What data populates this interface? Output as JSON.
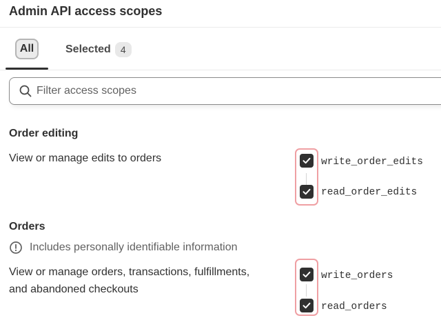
{
  "header": {
    "title": "Admin API access scopes"
  },
  "tabs": {
    "all_label": "All",
    "selected_label": "Selected",
    "selected_count": "4"
  },
  "search": {
    "placeholder": "Filter access scopes",
    "value": ""
  },
  "sections": [
    {
      "title": "Order editing",
      "description": "View or manage edits to orders",
      "scopes": [
        {
          "label": "write_order_edits",
          "checked": true
        },
        {
          "label": "read_order_edits",
          "checked": true
        }
      ]
    },
    {
      "title": "Orders",
      "notice": "Includes personally identifiable information",
      "description_line1": "View or manage orders, transactions, fulfillments,",
      "description_line2": "and abandoned checkouts",
      "scopes": [
        {
          "label": "write_orders",
          "checked": true
        },
        {
          "label": "read_orders",
          "checked": true
        }
      ]
    }
  ],
  "icons": {
    "search": "search-icon",
    "notice": "alert-circle-icon",
    "check": "checkmark-icon"
  },
  "colors": {
    "text": "#303030",
    "checkbox_fill": "#303030",
    "highlight_border": "#ef9fa3",
    "tab_active_bg": "#ebebeb"
  }
}
